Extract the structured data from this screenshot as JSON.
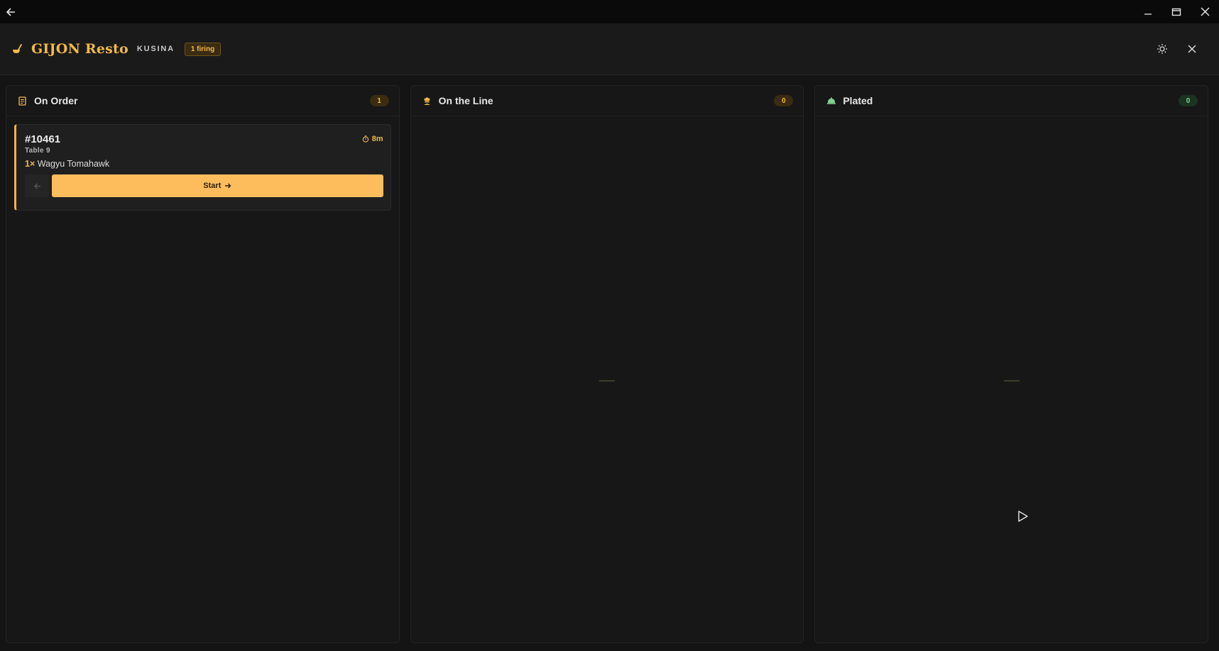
{
  "app": {
    "brand_name": "GIJON Resto",
    "station": "KUSINA",
    "firing_badge": "1 firing"
  },
  "icons": {
    "back": "arrow-left-icon",
    "minimize": "minimize-icon",
    "maximize": "maximize-icon",
    "close": "close-icon",
    "logo": "ladle-icon",
    "theme": "sun-icon",
    "exit": "close-icon"
  },
  "colors": {
    "accent": "#f2b94a",
    "button": "#fdbd5d",
    "plated": "#7fd394",
    "background": "#141414"
  },
  "columns": [
    {
      "title": "On Order",
      "count": "1",
      "icon": "receipt-icon"
    },
    {
      "title": "On the Line",
      "count": "0",
      "icon": "chef-icon"
    },
    {
      "title": "Plated",
      "count": "0",
      "icon": "cloche-icon"
    }
  ],
  "ticket": {
    "id": "#10461",
    "timer": "8m",
    "table": "Table 9",
    "item_qty": "1×",
    "item_name": "Wagyu Tomahawk",
    "start_label": "Start"
  }
}
